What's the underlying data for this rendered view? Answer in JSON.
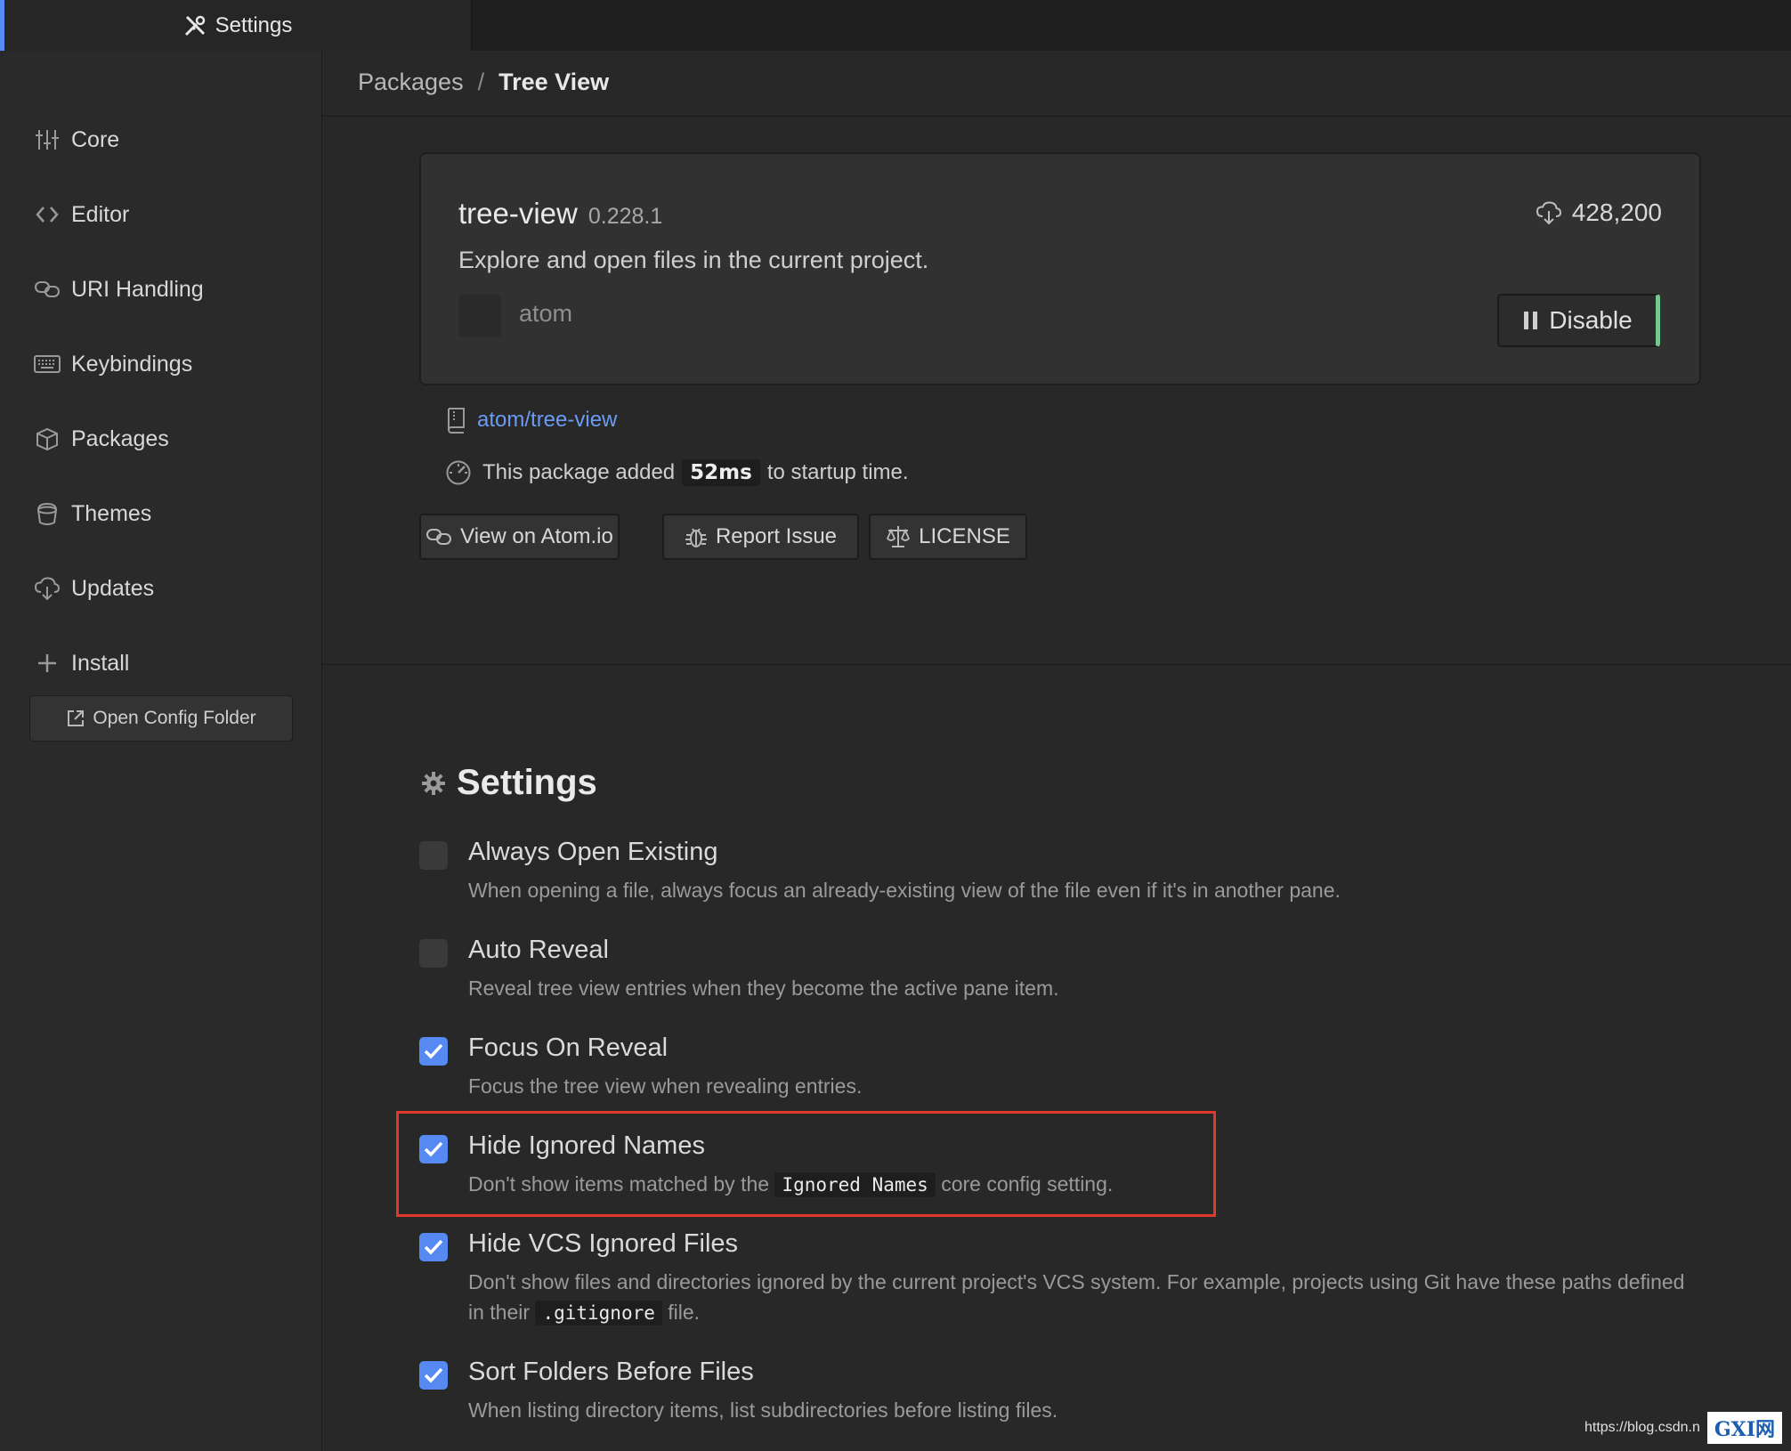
{
  "tab": {
    "title": "Settings"
  },
  "sidebar": {
    "items": [
      {
        "label": "Core",
        "icon": "sliders-icon"
      },
      {
        "label": "Editor",
        "icon": "code-icon"
      },
      {
        "label": "URI Handling",
        "icon": "link-icon"
      },
      {
        "label": "Keybindings",
        "icon": "keyboard-icon"
      },
      {
        "label": "Packages",
        "icon": "package-icon"
      },
      {
        "label": "Themes",
        "icon": "paintcan-icon"
      },
      {
        "label": "Updates",
        "icon": "cloud-download-icon"
      },
      {
        "label": "Install",
        "icon": "plus-icon"
      }
    ],
    "open_config_label": "Open Config Folder"
  },
  "breadcrumb": {
    "parent": "Packages",
    "separator": "/",
    "current": "Tree View"
  },
  "package": {
    "name": "tree-view",
    "version": "0.228.1",
    "description": "Explore and open files in the current project.",
    "author": "atom",
    "downloads": "428,200",
    "disable_label": "Disable",
    "repo_link": "atom/tree-view",
    "startup_prefix": "This package added",
    "startup_time": "52ms",
    "startup_suffix": "to startup time.",
    "buttons": {
      "view": "View on Atom.io",
      "report": "Report Issue",
      "license": "LICENSE"
    }
  },
  "settings": {
    "title": "Settings",
    "items": [
      {
        "title": "Always Open Existing",
        "desc": "When opening a file, always focus an already-existing view of the file even if it's in another pane.",
        "checked": false
      },
      {
        "title": "Auto Reveal",
        "desc": "Reveal tree view entries when they become the active pane item.",
        "checked": false
      },
      {
        "title": "Focus On Reveal",
        "desc": "Focus the tree view when revealing entries.",
        "checked": true
      },
      {
        "title": "Hide Ignored Names",
        "desc_pre": "Don't show items matched by the",
        "desc_code": "Ignored Names",
        "desc_post": "core config setting.",
        "checked": true
      },
      {
        "title": "Hide VCS Ignored Files",
        "desc_pre": "Don't show files and directories ignored by the current project's VCS system. For example, projects using Git have these paths defined in their",
        "desc_code": ".gitignore",
        "desc_post": "file.",
        "checked": true
      },
      {
        "title": "Sort Folders Before Files",
        "desc": "When listing directory items, list subdirectories before listing files.",
        "checked": true
      }
    ]
  },
  "watermark": {
    "url": "https://blog.csdn.n",
    "logo": "GXI网"
  },
  "colors": {
    "accent": "#568af2",
    "highlight": "#e0392b",
    "enabled": "#73c990"
  }
}
